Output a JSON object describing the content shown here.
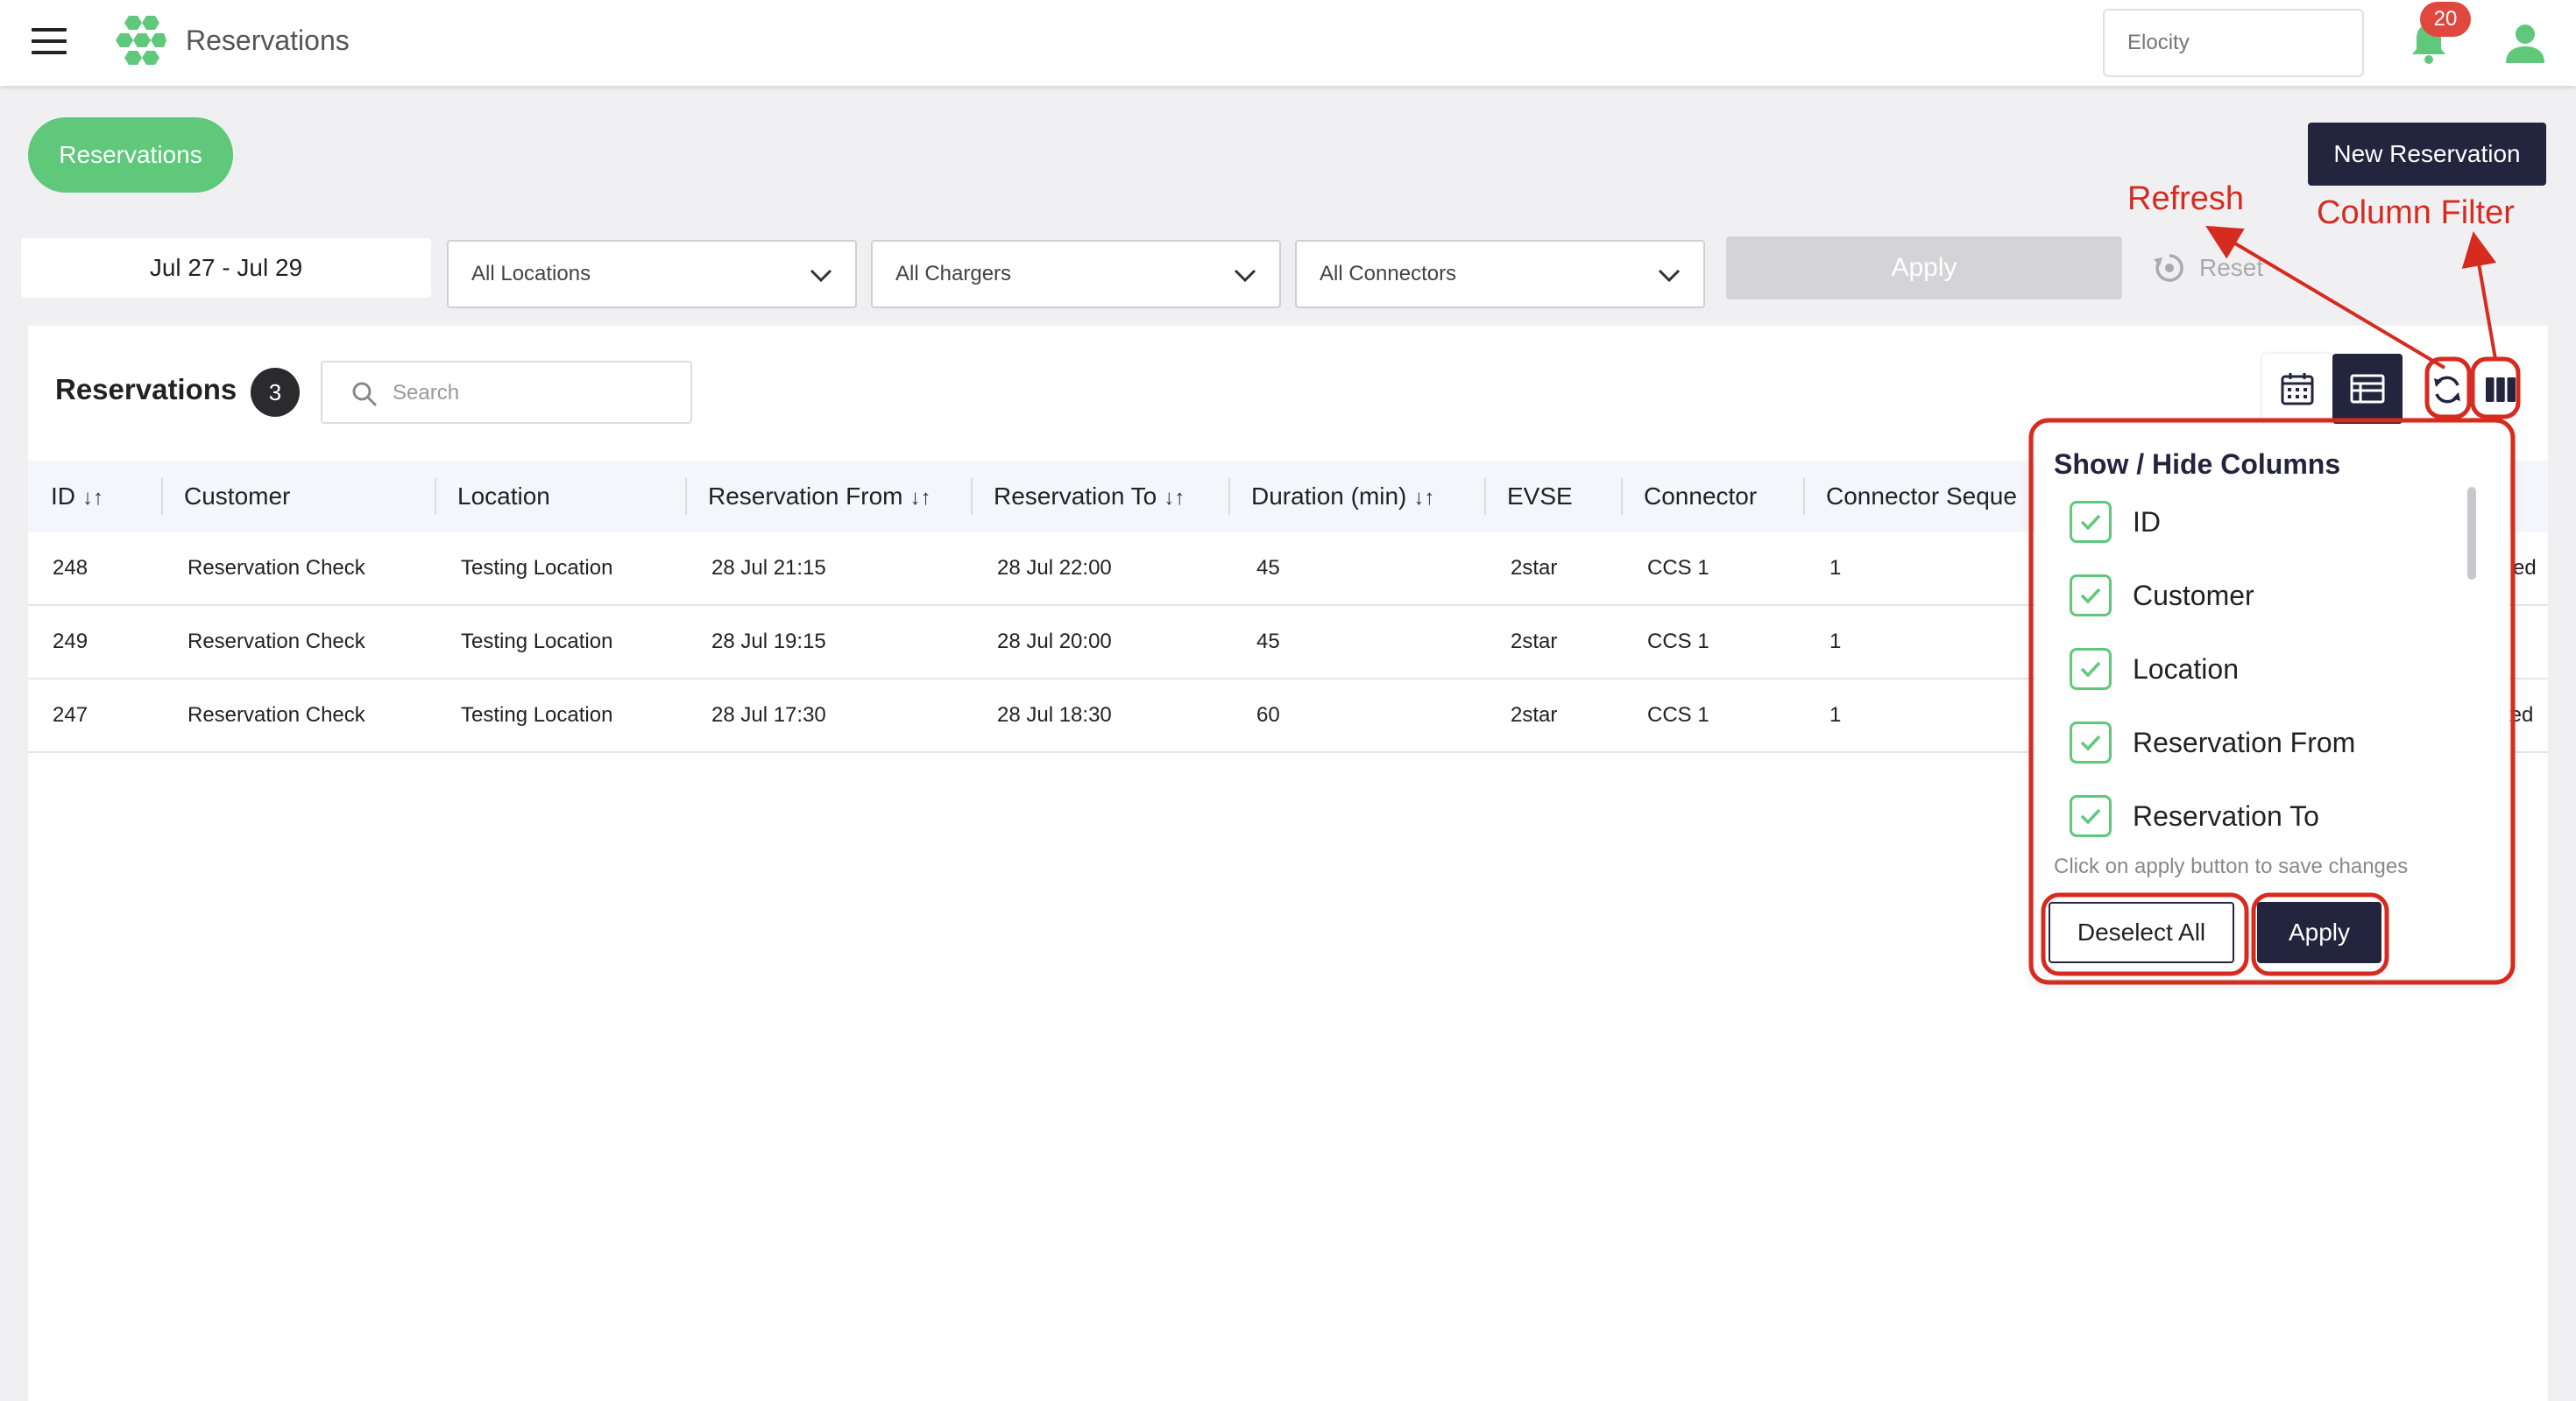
{
  "topbar": {
    "title": "Reservations",
    "tenant_placeholder": "Elocity",
    "notification_count": "20"
  },
  "header": {
    "pill_label": "Reservations",
    "new_button": "New Reservation"
  },
  "filters": {
    "date_range": "Jul 27 - Jul 29",
    "locations": "All Locations",
    "chargers": "All Chargers",
    "connectors": "All Connectors",
    "apply": "Apply",
    "reset": "Reset"
  },
  "card": {
    "title": "Reservations",
    "count": "3",
    "search_placeholder": "Search"
  },
  "table": {
    "sort_glyph": "↓↑",
    "columns": [
      "ID",
      "Customer",
      "Location",
      "Reservation From",
      "Reservation To",
      "Duration (min)",
      "EVSE",
      "Connector",
      "Connector Seque"
    ],
    "rows": [
      {
        "id": "248",
        "customer": "Reservation Check",
        "location": "Testing Location",
        "from": "28 Jul 21:15",
        "to": "28 Jul 22:00",
        "duration": "45",
        "evse": "2star",
        "connector": "CCS 1",
        "sequence": "1",
        "tail": "ed"
      },
      {
        "id": "249",
        "customer": "Reservation Check",
        "location": "Testing Location",
        "from": "28 Jul 19:15",
        "to": "28 Jul 20:00",
        "duration": "45",
        "evse": "2star",
        "connector": "CCS 1",
        "sequence": "1",
        "tail": ""
      },
      {
        "id": "247",
        "customer": "Reservation Check",
        "location": "Testing Location",
        "from": "28 Jul 17:30",
        "to": "28 Jul 18:30",
        "duration": "60",
        "evse": "2star",
        "connector": "CCS 1",
        "sequence": "1",
        "tail": "ted"
      }
    ]
  },
  "column_popover": {
    "title": "Show / Hide Columns",
    "items": [
      "ID",
      "Customer",
      "Location",
      "Reservation From",
      "Reservation To"
    ],
    "note": "Click on apply button to save changes",
    "deselect": "Deselect All",
    "apply": "Apply"
  },
  "annotations": {
    "refresh": "Refresh",
    "column_filter": "Column Filter",
    "color": "#d62b1f"
  },
  "colors": {
    "accent_green": "#5fc87a",
    "navy": "#23243d",
    "badge_red": "#e0473d"
  }
}
